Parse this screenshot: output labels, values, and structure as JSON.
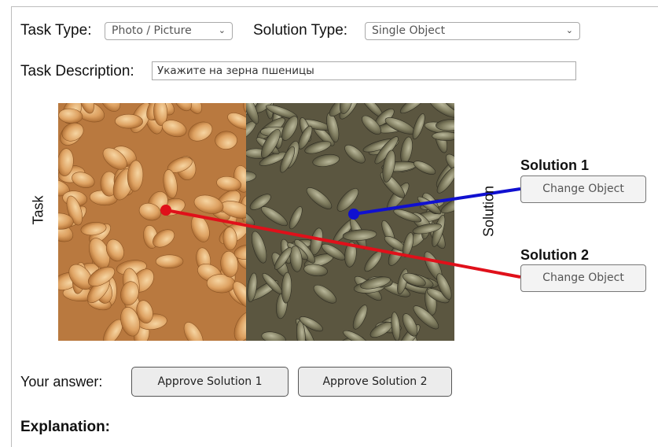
{
  "task_type": {
    "label": "Task Type:",
    "selected": "Photo / Picture"
  },
  "solution_type": {
    "label": "Solution Type:",
    "selected": "Single Object"
  },
  "task_description": {
    "label": "Task Description:",
    "value": "Укажите на зерна пшеницы"
  },
  "image_labels": {
    "task": "Task",
    "solution": "Solution"
  },
  "solutions": [
    {
      "title": "Solution 1",
      "button": "Change Object",
      "line_color": "#1010d0"
    },
    {
      "title": "Solution 2",
      "button": "Change Object",
      "line_color": "#e0101a"
    }
  ],
  "answer": {
    "label": "Your answer:",
    "approve_1": "Approve Solution 1",
    "approve_2": "Approve Solution 2"
  },
  "explanation": {
    "label": "Explanation:"
  },
  "icons": {
    "dropdown": "chevron-down-icon"
  }
}
